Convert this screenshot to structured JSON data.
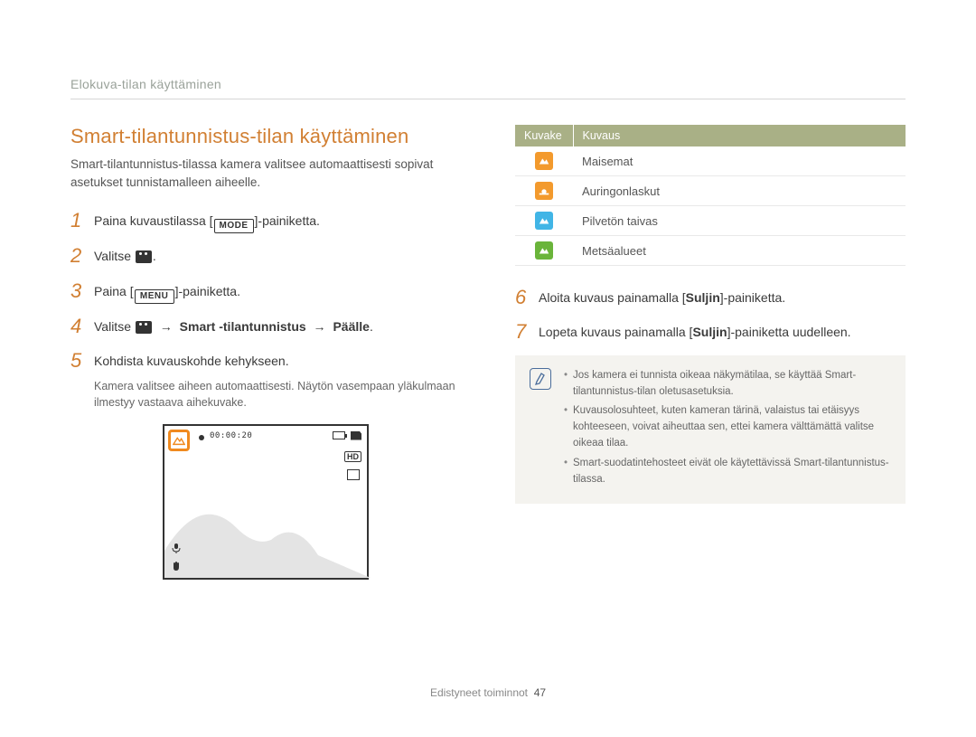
{
  "breadcrumb": "Elokuva-tilan käyttäminen",
  "title": "Smart-tilantunnistus-tilan käyttäminen",
  "intro": "Smart-tilantunnistus-tilassa kamera valitsee automaattisesti sopivat asetukset tunnistamalleen aiheelle.",
  "stepsLeft": [
    {
      "num": "1",
      "pre": "Paina kuvaustilassa [",
      "icon": "MODE",
      "post": "]-painiketta."
    },
    {
      "num": "2",
      "pre": "Valitse ",
      "icon": "video",
      "post": "."
    },
    {
      "num": "3",
      "pre": "Paina [",
      "icon": "MENU",
      "post": "]-painiketta."
    },
    {
      "num": "4",
      "pre": "Valitse ",
      "icon": "video",
      "arrow1": " → ",
      "bold1": "Smart -tilantunnistus",
      "arrow2": " → ",
      "bold2": "Päälle",
      "post": "."
    },
    {
      "num": "5",
      "pre": "Kohdista kuvauskohde kehykseen.",
      "sub": "Kamera valitsee aiheen automaattisesti. Näytön vasempaan yläkulmaan ilmestyy vastaava aihekuvake."
    }
  ],
  "stepsRight": [
    {
      "num": "6",
      "pre": "Aloita kuvaus painamalla [",
      "bold": "Suljin",
      "post": "]-painiketta."
    },
    {
      "num": "7",
      "pre": "Lopeta kuvaus painamalla [",
      "bold": "Suljin",
      "post": "]-painiketta uudelleen."
    }
  ],
  "screen": {
    "time": "00:00:20",
    "hd": "HD"
  },
  "table": {
    "h1": "Kuvake",
    "h2": "Kuvaus",
    "rows": [
      {
        "bg": "#f39a2d",
        "shape": "landscape",
        "label": "Maisemat"
      },
      {
        "bg": "#f39a2d",
        "shape": "sunset",
        "label": "Auringonlaskut"
      },
      {
        "bg": "#41b5e6",
        "shape": "landscape",
        "label": "Pilvetön taivas"
      },
      {
        "bg": "#6ab43a",
        "shape": "landscape",
        "label": "Metsäalueet"
      }
    ]
  },
  "notes": [
    "Jos kamera ei tunnista oikeaa näkymätilaa, se käyttää Smart-tilantunnistus-tilan oletusasetuksia.",
    "Kuvausolosuhteet, kuten kameran tärinä, valaistus tai etäisyys kohteeseen, voivat aiheuttaa sen, ettei kamera välttämättä valitse oikeaa tilaa.",
    "Smart-suodatintehosteet eivät ole käytettävissä Smart-tilantunnistus-tilassa."
  ],
  "footer": {
    "section": "Edistyneet toiminnot",
    "page": "47"
  }
}
